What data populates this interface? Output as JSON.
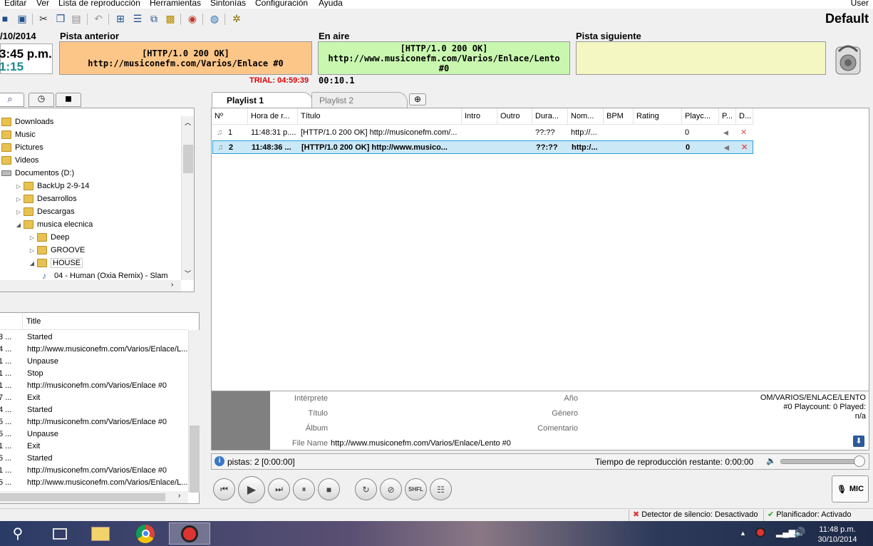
{
  "menu": [
    "Editar",
    "Ver",
    "Lista de reproducción",
    "Herramientas",
    "Sintonías",
    "Configuración",
    "Ayuda"
  ],
  "user_label": "User",
  "profile_name": "Default",
  "clock": {
    "date": "/10/2014",
    "time": "3:45 p.m.",
    "sub": "1:15"
  },
  "prev_track": {
    "label": "Pista anterior",
    "line1": "[HTTP/1.0 200 OK]",
    "line2": "http://musiconefm.com/Varios/Enlace #0",
    "color": "#fdc689"
  },
  "on_air": {
    "label": "En aire",
    "line1": "[HTTP/1.0 200 OK]",
    "line2": "http://www.musiconefm.com/Varios/Enlace/Lento",
    "line3": "#0",
    "elapsed": "00:10.1",
    "color": "#c9f7b0"
  },
  "next_track": {
    "label": "Pista siguiente",
    "color": "#f4f7c2"
  },
  "trial_text": "TRIAL: 04:59:39",
  "browser_tabs": [
    "search-icon",
    "clock-icon",
    "cue-icon"
  ],
  "tree": [
    {
      "label": "Downloads",
      "indent": 0,
      "type": "folder",
      "arrow": ""
    },
    {
      "label": "Music",
      "indent": 0,
      "type": "folder",
      "arrow": ""
    },
    {
      "label": "Pictures",
      "indent": 0,
      "type": "folder",
      "arrow": ""
    },
    {
      "label": "Videos",
      "indent": 0,
      "type": "folder",
      "arrow": ""
    },
    {
      "label": "Documentos (D:)",
      "indent": 0,
      "type": "drive",
      "arrow": ""
    },
    {
      "label": "BackUp 2-9-14",
      "indent": 1,
      "type": "folder",
      "arrow": "▷"
    },
    {
      "label": "Desarrollos",
      "indent": 1,
      "type": "folder",
      "arrow": "▷"
    },
    {
      "label": "Descargas",
      "indent": 1,
      "type": "folder",
      "arrow": "▷"
    },
    {
      "label": "musica elecnica",
      "indent": 1,
      "type": "folder",
      "arrow": "◢"
    },
    {
      "label": "Deep",
      "indent": 2,
      "type": "folder",
      "arrow": "▷"
    },
    {
      "label": "GROOVE",
      "indent": 2,
      "type": "folder",
      "arrow": "▷"
    },
    {
      "label": "HOUSE",
      "indent": 2,
      "type": "folder",
      "arrow": "◢"
    },
    {
      "label": "04 - Human (Oxia Remix) - Slam",
      "indent": 3,
      "type": "file",
      "arrow": ""
    }
  ],
  "log": {
    "header": "Title",
    "rows": [
      {
        "c": "3 ...",
        "t": "Started"
      },
      {
        "c": "4 ...",
        "t": "http://www.musiconefm.com/Varios/Enlace/L..."
      },
      {
        "c": "1 ...",
        "t": "Unpause"
      },
      {
        "c": "1 ...",
        "t": "Stop"
      },
      {
        "c": "1 ...",
        "t": "http://musiconefm.com/Varios/Enlace #0"
      },
      {
        "c": "7 ...",
        "t": "Exit"
      },
      {
        "c": "4 ...",
        "t": "Started"
      },
      {
        "c": "5 ...",
        "t": "http://musiconefm.com/Varios/Enlace #0"
      },
      {
        "c": "5 ...",
        "t": "Unpause"
      },
      {
        "c": "1 ...",
        "t": "Exit"
      },
      {
        "c": "5 ...",
        "t": "Started"
      },
      {
        "c": "1 ...",
        "t": "http://musiconefm.com/Varios/Enlace #0"
      },
      {
        "c": "5 ...",
        "t": "http://www.musiconefm.com/Varios/Enlace/L..."
      }
    ]
  },
  "playlist_tabs": [
    "Playlist 1",
    "Playlist 2"
  ],
  "playlist_columns": [
    "Nº",
    "Hora de r...",
    "Título",
    "Intro",
    "Outro",
    "Dura...",
    "Nom...",
    "BPM",
    "Rating",
    "Playc...",
    "P...",
    "D..."
  ],
  "playlist_rows": [
    {
      "n": "1",
      "hora": "11:48:31 p....",
      "titulo": "[HTTP/1.0 200 OK] http://musiconefm.com/...",
      "dur": "??:??",
      "nom": "http://...",
      "playc": "0",
      "bold": false,
      "selected": false
    },
    {
      "n": "2",
      "hora": "11:48:36 ...",
      "titulo": "[HTTP/1.0 200 OK] http://www.musico...",
      "dur": "??:??",
      "nom": "http:/...",
      "playc": "0",
      "bold": true,
      "selected": true
    }
  ],
  "info": {
    "interprete_label": "Intérprete",
    "titulo_label": "Título",
    "album_label": "Álbum",
    "filename_label": "File Name",
    "filename_value": "http://www.musiconefm.com/Varios/Enlace/Lento #0",
    "anio_label": "Año",
    "genero_label": "Género",
    "comentario_label": "Comentario",
    "right_line1": "OM/VARIOS/ENLACE/LENTO",
    "right_line2": "#0 Playcount: 0  Played:",
    "right_line3": "n/a"
  },
  "status": {
    "pistas": "pistas: 2 [0:00:00]",
    "remaining": "Tiempo de reproducción restante: 0:00:00",
    "volume": 1.0
  },
  "transport": [
    "previous-icon",
    "play-icon",
    "next-icon",
    "pause-icon",
    "stop-icon",
    "loop-icon",
    "disable-icon",
    "shuffle-icon",
    "list-icon"
  ],
  "shuffle_label": "SHFL",
  "mic_label": "MIC",
  "statusbar": {
    "silence": "Detector de silencio: Desactivado",
    "scheduler": "Planificador: Activado"
  },
  "taskbar": {
    "time": "11:48 p.m.",
    "date": "30/10/2014"
  }
}
